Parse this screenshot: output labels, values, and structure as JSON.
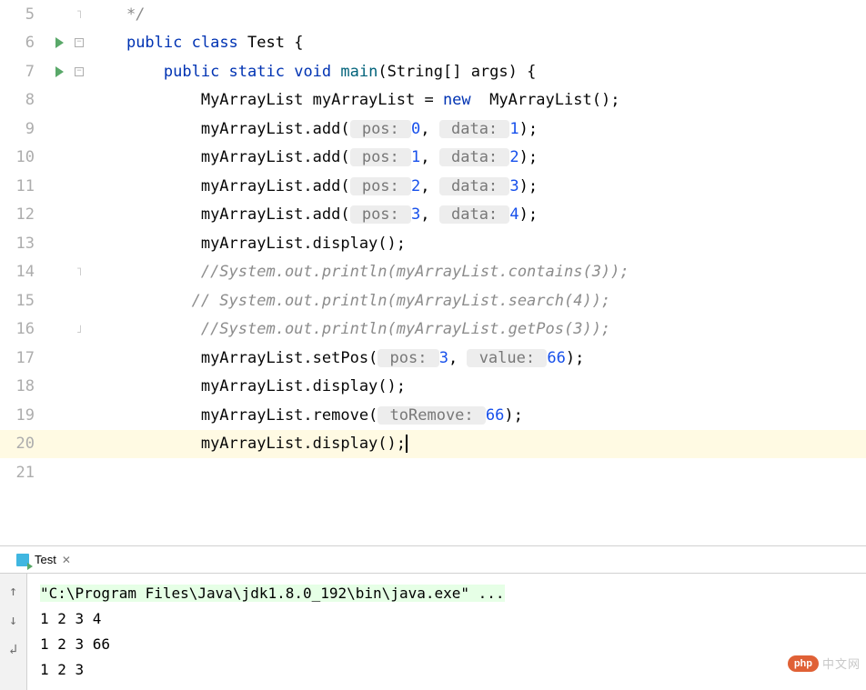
{
  "lines": {
    "5": {
      "num": "5",
      "indent": "    ",
      "tokens": [
        {
          "t": "*/",
          "c": "comment"
        }
      ]
    },
    "6": {
      "num": "6",
      "indent": "    ",
      "tokens": [
        {
          "t": "public ",
          "c": "kw"
        },
        {
          "t": "class ",
          "c": "kw"
        },
        {
          "t": "Test ",
          "c": "cls"
        },
        {
          "t": "{",
          "c": "op"
        }
      ]
    },
    "7": {
      "num": "7",
      "indent": "        ",
      "tokens": [
        {
          "t": "public ",
          "c": "kw"
        },
        {
          "t": "static ",
          "c": "kw"
        },
        {
          "t": "void ",
          "c": "kw"
        },
        {
          "t": "main",
          "c": "mtd"
        },
        {
          "t": "(String[] args) {",
          "c": "plain"
        }
      ]
    },
    "8": {
      "num": "8",
      "indent": "            ",
      "tokens": [
        {
          "t": "MyArrayList myArrayList = ",
          "c": "plain"
        },
        {
          "t": "new  ",
          "c": "kw"
        },
        {
          "t": "MyArrayList()",
          "c": "plain"
        },
        {
          "t": ";",
          "c": "op"
        }
      ]
    },
    "9": {
      "num": "9",
      "indent": "            ",
      "tokens": [
        {
          "t": "myArrayList.add(",
          "c": "plain"
        },
        {
          "t": " pos: ",
          "c": "hint",
          "box": true
        },
        {
          "t": "0",
          "c": "num"
        },
        {
          "t": ", ",
          "c": "op"
        },
        {
          "t": " data: ",
          "c": "hint",
          "box": true
        },
        {
          "t": "1",
          "c": "num"
        },
        {
          "t": ");",
          "c": "op"
        }
      ]
    },
    "10": {
      "num": "10",
      "indent": "            ",
      "tokens": [
        {
          "t": "myArrayList.add(",
          "c": "plain"
        },
        {
          "t": " pos: ",
          "c": "hint",
          "box": true
        },
        {
          "t": "1",
          "c": "num"
        },
        {
          "t": ", ",
          "c": "op"
        },
        {
          "t": " data: ",
          "c": "hint",
          "box": true
        },
        {
          "t": "2",
          "c": "num"
        },
        {
          "t": ");",
          "c": "op"
        }
      ]
    },
    "11": {
      "num": "11",
      "indent": "            ",
      "tokens": [
        {
          "t": "myArrayList.add(",
          "c": "plain"
        },
        {
          "t": " pos: ",
          "c": "hint",
          "box": true
        },
        {
          "t": "2",
          "c": "num"
        },
        {
          "t": ", ",
          "c": "op"
        },
        {
          "t": " data: ",
          "c": "hint",
          "box": true
        },
        {
          "t": "3",
          "c": "num"
        },
        {
          "t": ");",
          "c": "op"
        }
      ]
    },
    "12": {
      "num": "12",
      "indent": "            ",
      "tokens": [
        {
          "t": "myArrayList.add(",
          "c": "plain"
        },
        {
          "t": " pos: ",
          "c": "hint",
          "box": true
        },
        {
          "t": "3",
          "c": "num"
        },
        {
          "t": ", ",
          "c": "op"
        },
        {
          "t": " data: ",
          "c": "hint",
          "box": true
        },
        {
          "t": "4",
          "c": "num"
        },
        {
          "t": ");",
          "c": "op"
        }
      ]
    },
    "13": {
      "num": "13",
      "indent": "            ",
      "tokens": [
        {
          "t": "myArrayList.display();",
          "c": "plain"
        }
      ]
    },
    "14": {
      "num": "14",
      "indent": "            ",
      "tokens": [
        {
          "t": "//System.out.println(myArrayList.contains(3));",
          "c": "comment"
        }
      ]
    },
    "15": {
      "num": "15",
      "indent": "           ",
      "tokens": [
        {
          "t": "// System.out.println(myArrayList.search(4));",
          "c": "comment"
        }
      ]
    },
    "16": {
      "num": "16",
      "indent": "            ",
      "tokens": [
        {
          "t": "//System.out.println(myArrayList.getPos(3));",
          "c": "comment"
        }
      ]
    },
    "17": {
      "num": "17",
      "indent": "            ",
      "tokens": [
        {
          "t": "myArrayList.setPos(",
          "c": "plain"
        },
        {
          "t": " pos: ",
          "c": "hint",
          "box": true
        },
        {
          "t": "3",
          "c": "num"
        },
        {
          "t": ", ",
          "c": "op"
        },
        {
          "t": " value: ",
          "c": "hint",
          "box": true
        },
        {
          "t": "66",
          "c": "num"
        },
        {
          "t": ");",
          "c": "op"
        }
      ]
    },
    "18": {
      "num": "18",
      "indent": "            ",
      "tokens": [
        {
          "t": "myArrayList.display();",
          "c": "plain"
        }
      ]
    },
    "19": {
      "num": "19",
      "indent": "            ",
      "tokens": [
        {
          "t": "myArrayList.remove(",
          "c": "plain"
        },
        {
          "t": " toRemove: ",
          "c": "hint",
          "box": true
        },
        {
          "t": "66",
          "c": "num"
        },
        {
          "t": ");",
          "c": "op"
        }
      ]
    },
    "20": {
      "num": "20",
      "indent": "            ",
      "tokens": [
        {
          "t": "myArrayList.display();",
          "c": "plain"
        }
      ],
      "highlight": true,
      "caret": true
    },
    "21": {
      "num": "21",
      "indent": "",
      "tokens": []
    }
  },
  "console": {
    "tab_name": "Test",
    "cmd": "\"C:\\Program Files\\Java\\jdk1.8.0_192\\bin\\java.exe\" ...",
    "out1": "1 2 3 4",
    "out2": "1 2 3 66",
    "out3": "1 2 3"
  },
  "watermark": {
    "badge": "php",
    "text": "中文网"
  }
}
